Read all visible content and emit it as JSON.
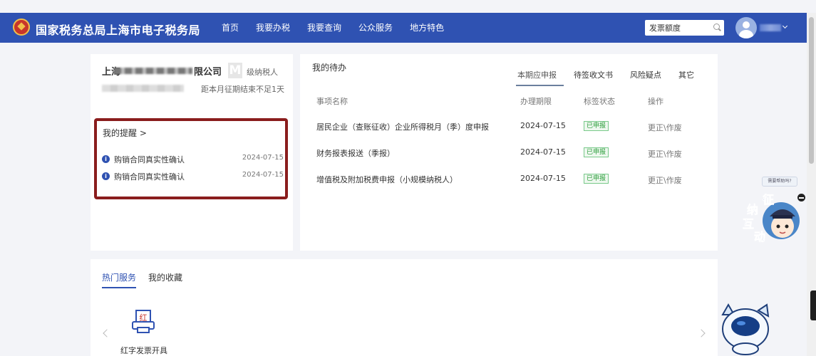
{
  "header": {
    "site_title": "国家税务总局上海市电子税务局",
    "nav": [
      "首页",
      "我要办税",
      "我要查询",
      "公众服务",
      "地方特色"
    ],
    "search_value": "发票额度"
  },
  "company": {
    "name_prefix": "上海",
    "name_suffix": "限公司",
    "level_badge": "M",
    "level_text": "级纳税人",
    "deadline": "距本月征期结束不足1天"
  },
  "reminders": {
    "title": "我的提醒 >",
    "items": [
      {
        "label": "购销合同真实性确认",
        "date": "2024-07-15"
      },
      {
        "label": "购销合同真实性确认",
        "date": "2024-07-15"
      }
    ]
  },
  "todo": {
    "title": "我的待办",
    "tabs": [
      "本期应申报",
      "待签收文书",
      "风险疑点",
      "其它"
    ],
    "columns": [
      "事项名称",
      "办理期限",
      "标签状态",
      "操作"
    ],
    "rows": [
      {
        "name": "居民企业（查账征收）企业所得税月（季）度申报",
        "deadline": "2024-07-15",
        "status": "已申报",
        "action": "更正\\作废"
      },
      {
        "name": "财务报表报送（季报）",
        "deadline": "2024-07-15",
        "status": "已申报",
        "action": "更正\\作废"
      },
      {
        "name": "增值税及附加税费申报（小规模纳税人）",
        "deadline": "2024-07-15",
        "status": "已申报",
        "action": "更正\\作废"
      }
    ]
  },
  "services": {
    "tabs": [
      "热门服务",
      "我的收藏"
    ],
    "items": [
      {
        "label": "红字发票开具",
        "icon_text": "红"
      }
    ]
  },
  "assistant": {
    "bubble": "需要帮助吗?",
    "chars": [
      "征",
      "纳",
      "互",
      "动"
    ]
  },
  "colors": {
    "brand": "#2f52b2",
    "reminder_border": "#8a1d1d",
    "status_green": "#2a9d3a"
  }
}
